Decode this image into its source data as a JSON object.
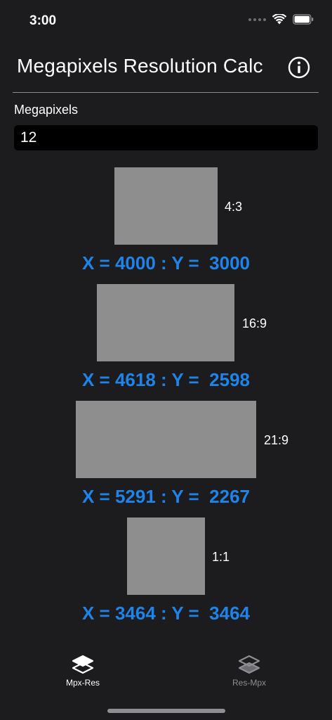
{
  "status_bar": {
    "time": "3:00"
  },
  "header": {
    "title": "Megapixels Resolution Calc"
  },
  "form": {
    "label": "Megapixels",
    "value": "12"
  },
  "ratios": [
    {
      "label": "4:3",
      "result": "X = 4000 : Y =  3000"
    },
    {
      "label": "16:9",
      "result": "X = 4618 : Y =  2598"
    },
    {
      "label": "21:9",
      "result": "X = 5291 : Y =  2267"
    },
    {
      "label": "1:1",
      "result": "X = 3464 : Y =  3464"
    }
  ],
  "tabs": [
    {
      "label": "Mpx-Res",
      "active": true
    },
    {
      "label": "Res-Mpx",
      "active": false
    }
  ],
  "colors": {
    "background": "#1c1c1e",
    "accent": "#1e84ea",
    "box": "#8e8e8e",
    "inactive": "#8e8e93"
  }
}
